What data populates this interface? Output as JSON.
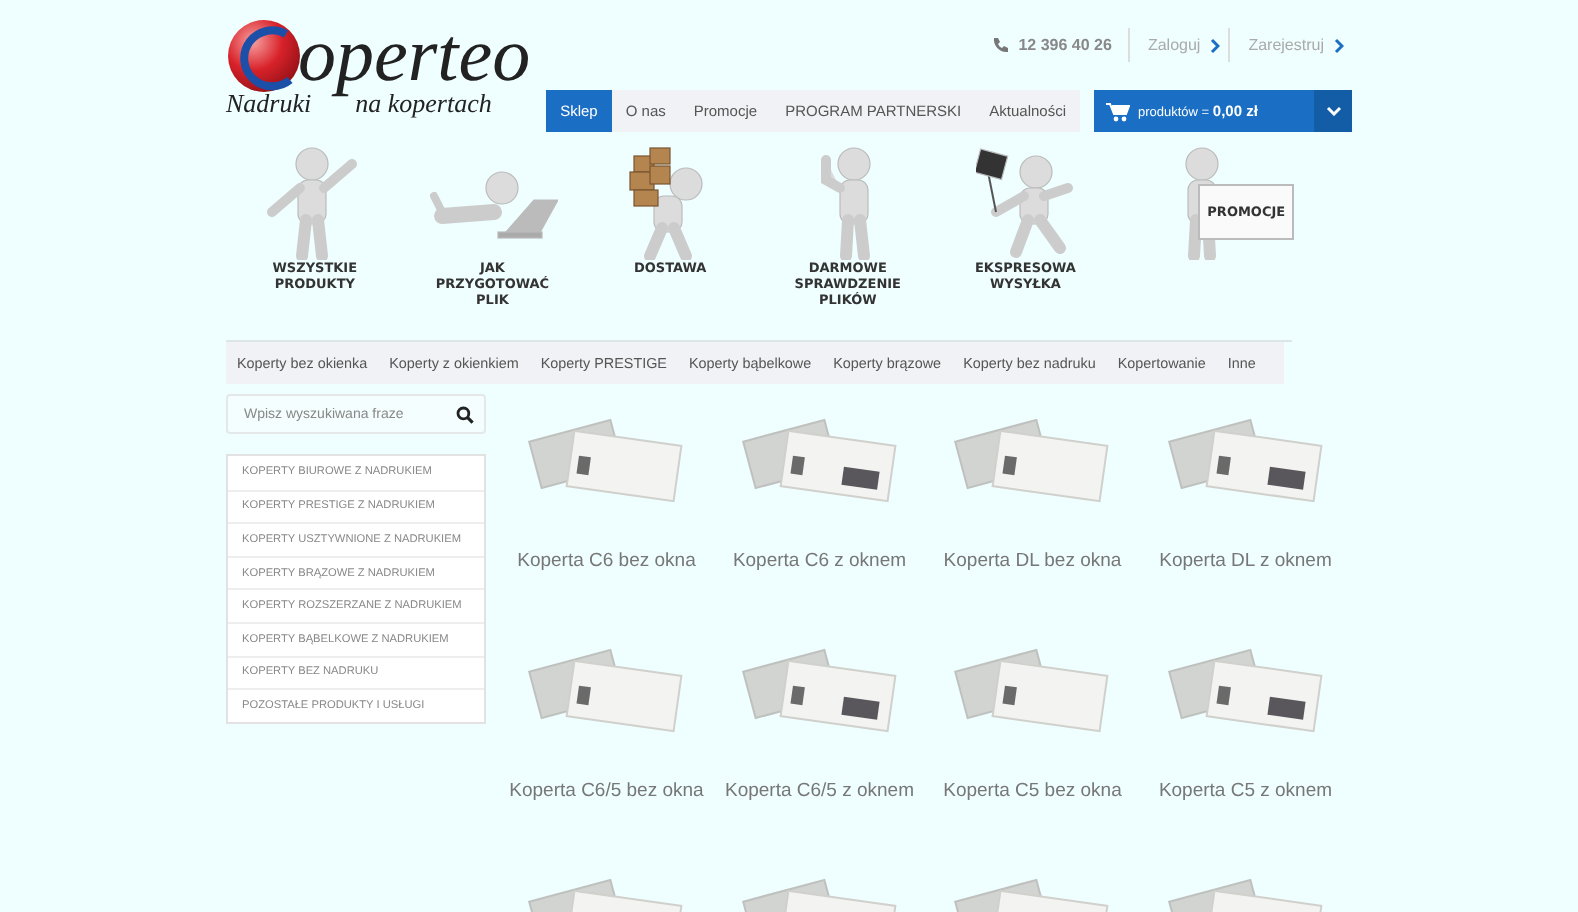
{
  "logo": {
    "wordmark": "operteo",
    "tagline_left": "Nadruki",
    "tagline_right": "na kopertach"
  },
  "contact": {
    "phone": "12 396 40 26",
    "login": "Zaloguj",
    "register": "Zarejestruj"
  },
  "main_nav": [
    {
      "label": "Sklep",
      "selected": true
    },
    {
      "label": "O nas",
      "selected": false
    },
    {
      "label": "Promocje",
      "selected": false
    },
    {
      "label": "PROGRAM PARTNERSKI",
      "selected": false
    },
    {
      "label": "Aktualności",
      "selected": false
    }
  ],
  "cart": {
    "summary": "produktów = **0,00 zł**"
  },
  "hero": [
    {
      "kind": "figure",
      "label": "WSZYSTKIE PRODUKTY"
    },
    {
      "kind": "figure",
      "label": "JAK PRZYGOTOWAĆ PLIK"
    },
    {
      "kind": "figure",
      "label": "DOSTAWA"
    },
    {
      "kind": "figure",
      "label": "DARMOWE SPRAWDZENIE PLIKÓW"
    },
    {
      "kind": "figure",
      "label": "EKSPRESOWA WYSYŁKA"
    },
    {
      "kind": "board",
      "label": "PROMOCJE"
    }
  ],
  "categories": [
    "Koperty bez okienka",
    "Koperty z okienkiem",
    "Koperty PRESTIGE",
    "Koperty bąbelkowe",
    "Koperty brązowe",
    "Koperty bez nadruku",
    "Kopertowanie",
    "Inne"
  ],
  "search": {
    "placeholder": "Wpisz wyszukiwana fraze"
  },
  "sidebar": {
    "items": [
      "KOPERTY BIUROWE Z NADRUKIEM",
      "KOPERTY PRESTIGE Z NADRUKIEM",
      "KOPERTY USZTYWNIONE Z NADRUKIEM",
      "KOPERTY BRĄZOWE Z NADRUKIEM",
      "KOPERTY ROZSZERZANE Z NADRUKIEM",
      "KOPERTY BĄBELKOWE Z NADRUKIEM",
      "KOPERTY BEZ NADRUKU",
      "POZOSTAŁE PRODUKTY I USŁUGI"
    ]
  },
  "products": [
    {
      "name": "Koperta C6 bez okna",
      "window": false
    },
    {
      "name": "Koperta C6 z oknem",
      "window": true
    },
    {
      "name": "Koperta DL bez okna",
      "window": false
    },
    {
      "name": "Koperta DL z oknem",
      "window": true
    },
    {
      "name": "Koperta C6/5 bez okna",
      "window": false
    },
    {
      "name": "Koperta C6/5 z oknem",
      "window": true
    },
    {
      "name": "Koperta C5 bez okna",
      "window": false
    },
    {
      "name": "Koperta C5 z oknem",
      "window": true
    }
  ]
}
